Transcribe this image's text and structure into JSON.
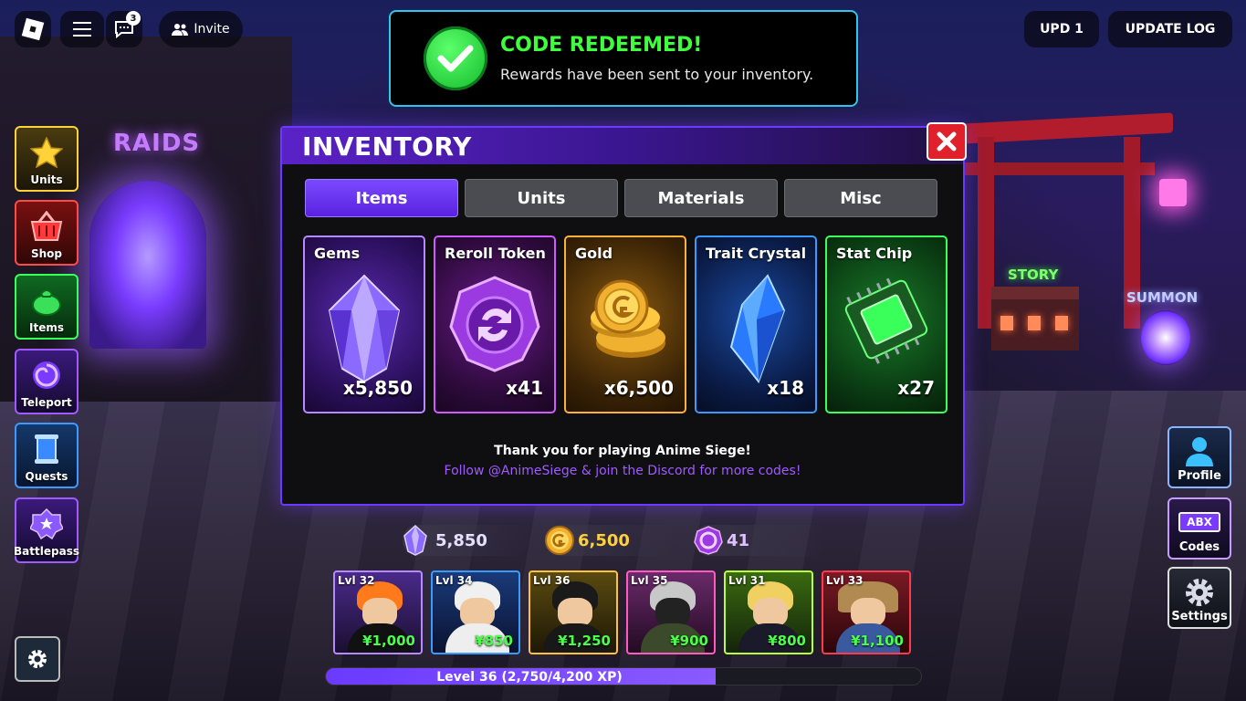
{
  "topbar": {
    "chat_badge": "3",
    "invite_label": "Invite",
    "upd_label": "UPD 1",
    "update_log_label": "UPDATE LOG"
  },
  "toast": {
    "title": "CODE REDEEMED!",
    "message": "Rewards have been sent to your inventory."
  },
  "world": {
    "raids_label": "RAIDS",
    "story_label": "STORY",
    "summon_label": "SUMMON"
  },
  "left_sidebar": [
    {
      "label": "Units",
      "icon": "star-icon"
    },
    {
      "label": "Shop",
      "icon": "basket-icon"
    },
    {
      "label": "Items",
      "icon": "bag-icon"
    },
    {
      "label": "Teleport",
      "icon": "swirl-icon"
    },
    {
      "label": "Quests",
      "icon": "scroll-icon"
    },
    {
      "label": "Battlepass",
      "icon": "badge-icon"
    }
  ],
  "right_sidebar": [
    {
      "label": "Profile",
      "icon": "person-icon"
    },
    {
      "label": "Codes",
      "icon": "codes-icon",
      "tag": "ABX"
    },
    {
      "label": "Settings",
      "icon": "gear-icon"
    }
  ],
  "inventory": {
    "title": "INVENTORY",
    "tabs": [
      "Items",
      "Units",
      "Materials",
      "Misc"
    ],
    "active_tab": "Items",
    "cards": [
      {
        "name": "Gems",
        "count": "x5,850"
      },
      {
        "name": "Reroll Token",
        "count": "x41"
      },
      {
        "name": "Gold",
        "count": "x6,500"
      },
      {
        "name": "Trait Crystal",
        "count": "x18"
      },
      {
        "name": "Stat Chip",
        "count": "x27"
      }
    ],
    "thanks": "Thank you for playing Anime Siege!",
    "follow": "Follow @AnimeSiege & join the Discord for more codes!"
  },
  "currency": {
    "gems": "5,850",
    "gold": "6,500",
    "reroll": "41"
  },
  "hotbar": [
    {
      "level": "Lvl 32",
      "cost": "¥1,000"
    },
    {
      "level": "Lvl 34",
      "cost": "¥850"
    },
    {
      "level": "Lvl 36",
      "cost": "¥1,250"
    },
    {
      "level": "Lvl 35",
      "cost": "¥900"
    },
    {
      "level": "Lvl 31",
      "cost": "¥800"
    },
    {
      "level": "Lvl 33",
      "cost": "¥1,100"
    }
  ],
  "xp": {
    "label": "Level 36 (2,750/4,200 XP)",
    "fraction": 0.655
  },
  "colors": {
    "accent_purple": "#6a3aff",
    "success_green": "#3dff3d",
    "close_red": "#e0202a"
  }
}
